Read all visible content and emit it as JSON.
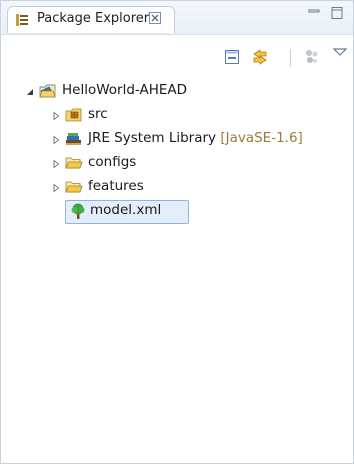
{
  "view": {
    "tab_label": "Package Explorer",
    "close_glyph": "☒"
  },
  "toolbar": {
    "buttons": [
      "collapse-all-icon",
      "link-with-editor-icon",
      "focus-task-icon",
      "view-menu-icon"
    ]
  },
  "tree": {
    "project": {
      "label": "HelloWorld-AHEAD",
      "icon": "java-project-icon",
      "expanded": true
    },
    "children": [
      {
        "label": "src",
        "decoration": "",
        "icon": "source-folder-icon"
      },
      {
        "label": "JRE System Library",
        "decoration": "[JavaSE-1.6]",
        "icon": "library-icon"
      },
      {
        "label": "configs",
        "decoration": "",
        "icon": "folder-icon"
      },
      {
        "label": "features",
        "decoration": "",
        "icon": "folder-icon"
      },
      {
        "label": "model.xml",
        "decoration": "",
        "icon": "tree-model-icon",
        "selected": true
      }
    ]
  },
  "colors": {
    "selection_bg": "#e4eefb",
    "selection_border": "#8fb3e3",
    "decoration": "#9a7d3a",
    "folder": "#f2c94c"
  }
}
